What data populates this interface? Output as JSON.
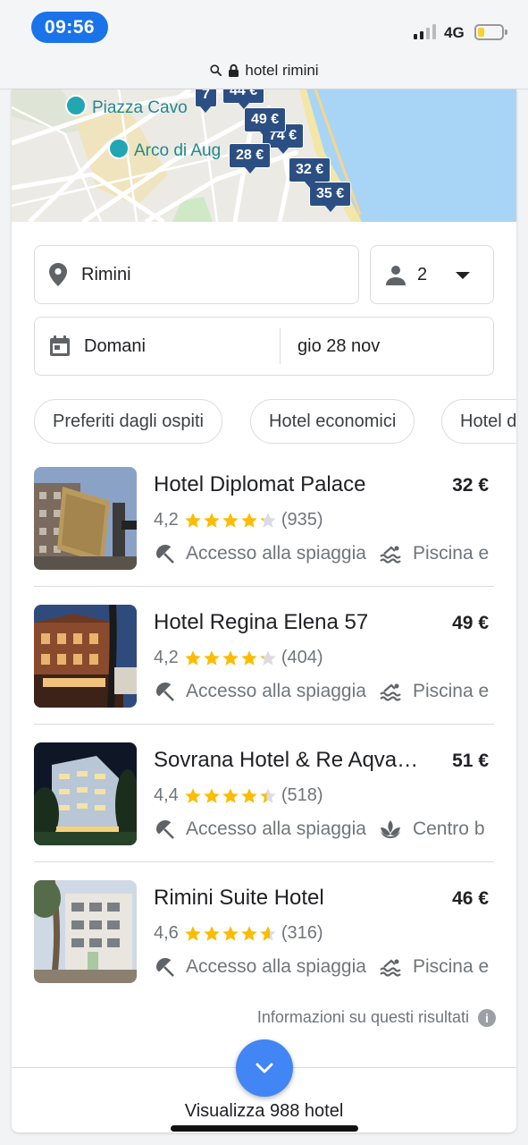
{
  "status_bar": {
    "time": "09:56",
    "network": "4G",
    "battery_level": 0.2,
    "signal_bars": 2
  },
  "url_bar": {
    "url": "hotel rimini",
    "icons": [
      "search-icon",
      "lock-icon"
    ]
  },
  "map": {
    "labels": [
      "Piazza Cavo",
      "Arco di Aug"
    ],
    "price_pins": [
      "7",
      "44 €",
      "49 €",
      "74 €",
      "28 €",
      "32 €",
      "35 €"
    ],
    "colors": {
      "sea": "#a8d5f5",
      "land": "#eceae4",
      "pin": "#2c4f83",
      "beach": "#f3e6a6"
    }
  },
  "search": {
    "location": "Rimini",
    "guests": "2",
    "checkin": "Domani",
    "checkout": "gio 28 nov"
  },
  "chips": [
    "Preferiti dagli ospiti",
    "Hotel economici",
    "Hotel d"
  ],
  "hotels": [
    {
      "name": "Hotel Diplomat Palace",
      "price": "32 €",
      "rating": "4,2",
      "stars": 4.2,
      "reviews": "(935)",
      "amenity1": "Accesso alla spiaggia",
      "amenity2": "Piscina e",
      "amenity2_icon": "pool-icon"
    },
    {
      "name": "Hotel Regina Elena 57",
      "price": "49 €",
      "rating": "4,2",
      "stars": 4.2,
      "reviews": "(404)",
      "amenity1": "Accesso alla spiaggia",
      "amenity2": "Piscina e",
      "amenity2_icon": "pool-icon"
    },
    {
      "name": "Sovrana Hotel & Re Aqva…",
      "price": "51 €",
      "rating": "4,4",
      "stars": 4.4,
      "reviews": "(518)",
      "amenity1": "Accesso alla spiaggia",
      "amenity2": "Centro b",
      "amenity2_icon": "spa-icon"
    },
    {
      "name": "Rimini Suite Hotel",
      "price": "46 €",
      "rating": "4,6",
      "stars": 4.6,
      "reviews": "(316)",
      "amenity1": "Accesso alla spiaggia",
      "amenity2": "Piscina e",
      "amenity2_icon": "pool-icon"
    }
  ],
  "footer": {
    "info_text": "Informazioni su questi risultati",
    "view_all": "Visualizza 988 hotel"
  },
  "colors": {
    "accent": "#1a73e8",
    "fab": "#4285f4",
    "star": "#fbbc04"
  }
}
